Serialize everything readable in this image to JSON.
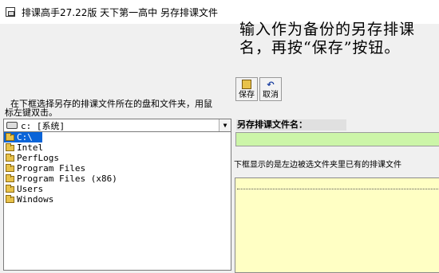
{
  "window": {
    "title": "排课高手27.22版 天下第一高中 另存排课文件"
  },
  "instruction": "输入作为备份的另存排课\n名，再按“保存”按钮。",
  "toolbar": {
    "save_label": "保存",
    "cancel_label": "取消"
  },
  "help_text": "  在下框选择另存的排课文件所在的盘和文件夹，用鼠\n标左键双击。",
  "drive_select": {
    "value": "c: [系统]"
  },
  "tree": {
    "root": "C:\\",
    "folders": [
      "Intel",
      "PerfLogs",
      "Program Files",
      "Program Files (x86)",
      "Users",
      "Windows"
    ]
  },
  "filename": {
    "label": "另存排课文件名：",
    "value": ""
  },
  "existing": {
    "label": "下框显示的是左边被选文件夹里已有的排课文件"
  }
}
